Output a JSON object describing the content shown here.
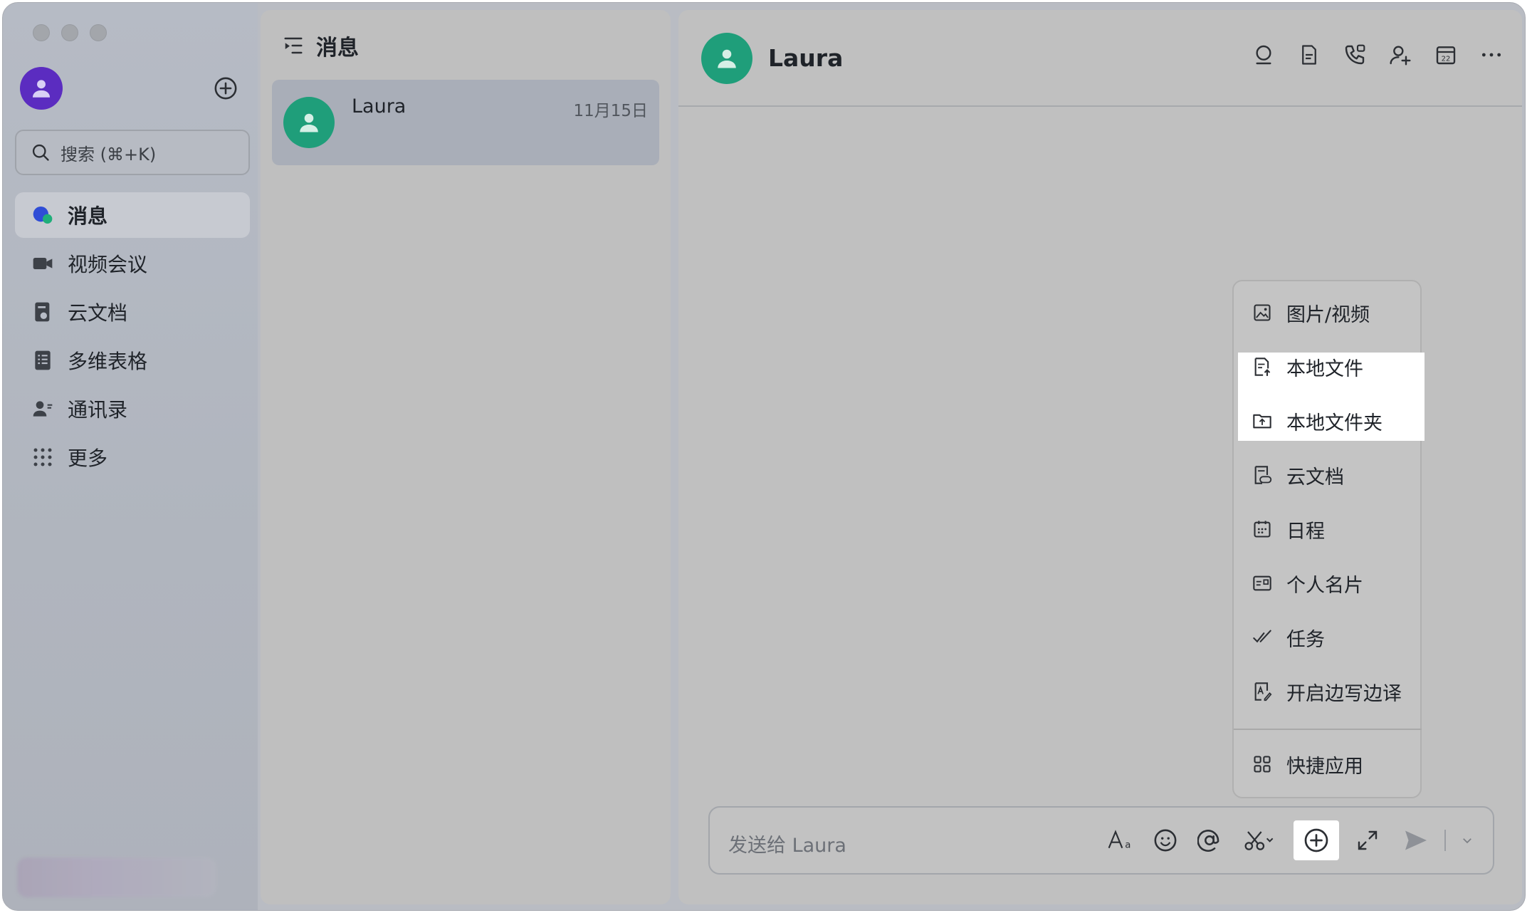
{
  "sidebar": {
    "search": {
      "label": "搜索 (⌘+K)"
    },
    "items": [
      {
        "label": "消息",
        "icon": "message-icon",
        "active": true
      },
      {
        "label": "视频会议",
        "icon": "video-camera-icon",
        "active": false
      },
      {
        "label": "云文档",
        "icon": "cloud-doc-icon",
        "active": false
      },
      {
        "label": "多维表格",
        "icon": "table-icon",
        "active": false
      },
      {
        "label": "通讯录",
        "icon": "contacts-icon",
        "active": false
      },
      {
        "label": "更多",
        "icon": "grid-dots-icon",
        "active": false
      }
    ]
  },
  "conversations": {
    "title": "消息",
    "items": [
      {
        "name": "Laura",
        "date": "11月15日"
      }
    ]
  },
  "chat": {
    "title": "Laura",
    "header_tools": [
      "search-icon",
      "document-icon",
      "phone-icon",
      "add-member-icon",
      "calendar-icon",
      "more-icon"
    ],
    "composer": {
      "placeholder": "发送给 Laura",
      "tools": [
        "font-icon",
        "emoji-icon",
        "mention-icon",
        "scissors-icon",
        "add-circle-icon",
        "expand-icon",
        "send-icon",
        "chevron-down-icon"
      ]
    }
  },
  "menu": {
    "items": [
      {
        "label": "图片/视频",
        "icon": "image-icon"
      },
      {
        "label": "本地文件",
        "icon": "file-upload-icon"
      },
      {
        "label": "本地文件夹",
        "icon": "folder-upload-icon"
      },
      {
        "label": "云文档",
        "icon": "cloud-doc-icon"
      },
      {
        "label": "日程",
        "icon": "calendar-icon"
      },
      {
        "label": "个人名片",
        "icon": "contact-card-icon"
      },
      {
        "label": "任务",
        "icon": "task-check-icon"
      },
      {
        "label": "开启边写边译",
        "icon": "translate-icon"
      },
      {
        "label": "快捷应用",
        "icon": "apps-grid-icon"
      }
    ]
  },
  "colors": {
    "avatar_me": "#5b2cc0",
    "avatar_contact": "#1f9e7a",
    "highlight": "#ffffff"
  }
}
